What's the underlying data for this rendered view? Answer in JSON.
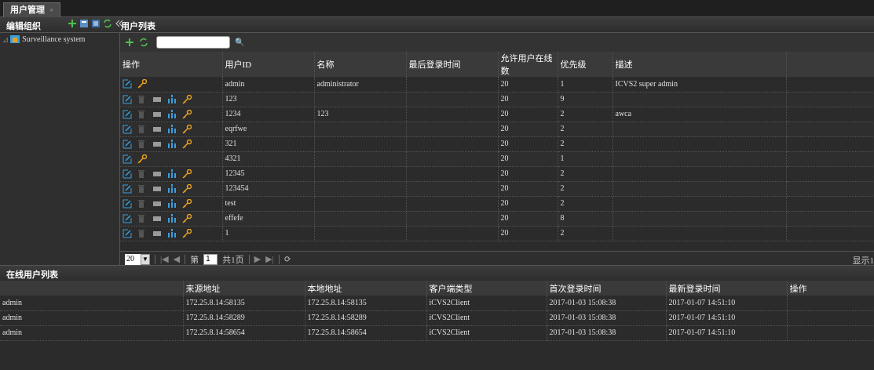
{
  "tab": {
    "title": "用户管理",
    "close": "×"
  },
  "header": {
    "left_title": "编辑组织",
    "right_title": "用户列表"
  },
  "tree": {
    "root": "Surveillance system",
    "expander": "◿"
  },
  "toolbar": {
    "search_placeholder": "",
    "search_glyph": "🔍"
  },
  "grid": {
    "columns": [
      "操作",
      "用户ID",
      "名称",
      "最后登录时间",
      "允许用户在线数",
      "优先级",
      "描述"
    ],
    "rows": [
      {
        "full": false,
        "id": "admin",
        "name": "administrator",
        "last": "",
        "online": "20",
        "pri": "1",
        "desc": "ICVS2 super admin"
      },
      {
        "full": true,
        "id": "123",
        "name": "",
        "last": "",
        "online": "20",
        "pri": "9",
        "desc": ""
      },
      {
        "full": true,
        "id": "1234",
        "name": "123",
        "last": "",
        "online": "20",
        "pri": "2",
        "desc": "awca"
      },
      {
        "full": true,
        "id": "eqrfwe",
        "name": "",
        "last": "",
        "online": "20",
        "pri": "2",
        "desc": ""
      },
      {
        "full": true,
        "id": "321",
        "name": "",
        "last": "",
        "online": "20",
        "pri": "2",
        "desc": ""
      },
      {
        "full": false,
        "id": "4321",
        "name": "",
        "last": "",
        "online": "20",
        "pri": "1",
        "desc": ""
      },
      {
        "full": true,
        "id": "12345",
        "name": "",
        "last": "",
        "online": "20",
        "pri": "2",
        "desc": ""
      },
      {
        "full": true,
        "id": "123454",
        "name": "",
        "last": "",
        "online": "20",
        "pri": "2",
        "desc": ""
      },
      {
        "full": true,
        "id": "test",
        "name": "",
        "last": "",
        "online": "20",
        "pri": "2",
        "desc": ""
      },
      {
        "full": true,
        "id": "effefe",
        "name": "",
        "last": "",
        "online": "20",
        "pri": "8",
        "desc": ""
      },
      {
        "full": true,
        "id": "1",
        "name": "",
        "last": "",
        "online": "20",
        "pri": "2",
        "desc": ""
      }
    ]
  },
  "pager": {
    "page_size": "20",
    "page_prefix": "第",
    "page_value": "1",
    "page_suffix": "共1页",
    "right_text": "显示1"
  },
  "online": {
    "title": "在线用户列表",
    "columns": [
      "",
      "来源地址",
      "本地地址",
      "客户端类型",
      "首次登录时间",
      "最新登录时间",
      "操作"
    ],
    "rows": [
      [
        "admin",
        "172.25.8.14:58135",
        "172.25.8.14:58135",
        "iCVS2Client",
        "2017-01-03 15:08:38",
        "2017-01-07 14:51:10",
        ""
      ],
      [
        "admin",
        "172.25.8.14:58289",
        "172.25.8.14:58289",
        "iCVS2Client",
        "2017-01-03 15:08:38",
        "2017-01-07 14:51:10",
        ""
      ],
      [
        "admin",
        "172.25.8.14:58654",
        "172.25.8.14:58654",
        "iCVS2Client",
        "2017-01-03 15:08:38",
        "2017-01-07 14:51:10",
        ""
      ]
    ]
  },
  "colors": {
    "edit": "#3aa0e0",
    "key": "#e8a020",
    "tree": "#3aa0e0",
    "plus": "#4cc04c"
  }
}
